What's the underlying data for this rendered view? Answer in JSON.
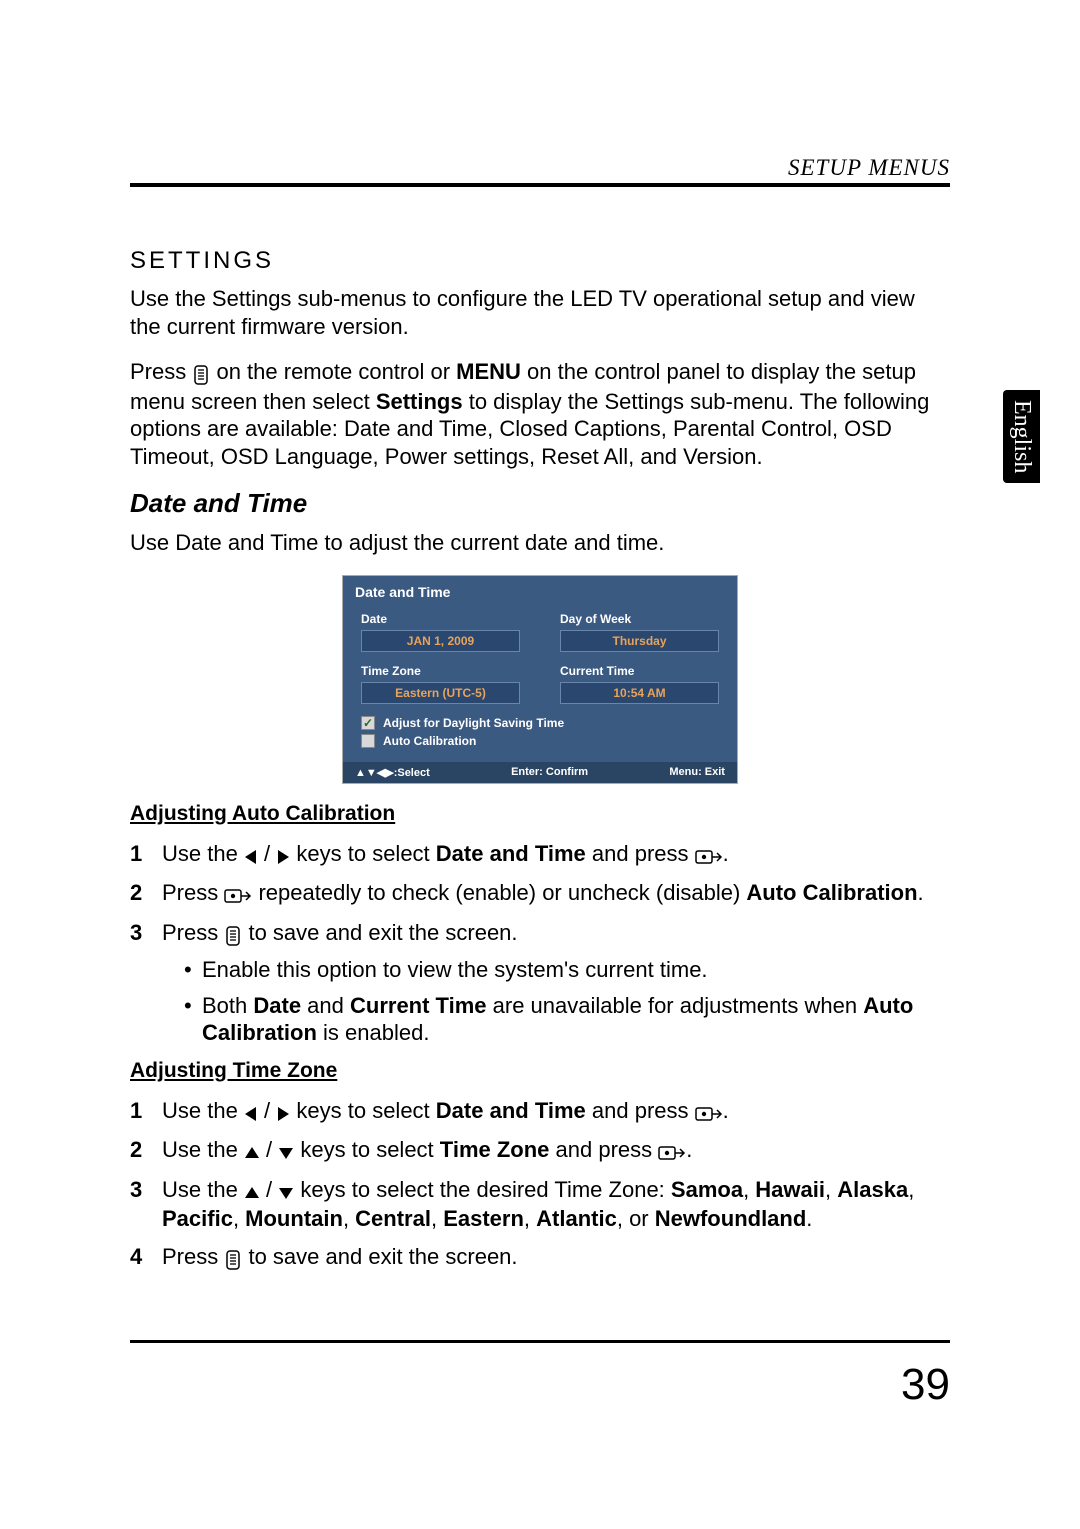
{
  "header": {
    "label": "SETUP MENUS"
  },
  "side_tab": "English",
  "page_number": "39",
  "settings": {
    "title": "SETTINGS",
    "intro": "Use the Settings sub-menus to configure the LED TV operational setup and view the current firmware version.",
    "press_pre": "Press ",
    "press_mid1": " on the remote control or ",
    "press_menu": "MENU",
    "press_mid2": " on the control panel to display the setup menu screen then select ",
    "press_settings": "Settings",
    "press_tail": " to display the Settings sub-menu. The following options are available: Date and Time, Closed Captions, Parental Control, OSD Timeout, OSD Language, Power settings, Reset All, and Version."
  },
  "date_time": {
    "heading": "Date and Time",
    "intro": "Use Date and Time to adjust the current date and time."
  },
  "osd": {
    "title": "Date and Time",
    "date_label": "Date",
    "date_value": "JAN 1, 2009",
    "dow_label": "Day of Week",
    "dow_value": "Thursday",
    "tz_label": "Time Zone",
    "tz_value": "Eastern (UTC-5)",
    "ct_label": "Current Time",
    "ct_value": "10:54 AM",
    "dst_label": "Adjust for Daylight Saving Time",
    "auto_label": "Auto Calibration",
    "footer_select": "▲▼◀▶:Select",
    "footer_enter": "Enter: Confirm",
    "footer_menu": "Menu: Exit"
  },
  "auto_cal": {
    "heading": "Adjusting Auto Calibration",
    "step1_a": "Use the ",
    "step1_b": " keys to select ",
    "step1_c": "Date and Time",
    "step1_d": " and press ",
    "step2_a": "Press ",
    "step2_b": " repeatedly to check (enable) or uncheck (disable) ",
    "step2_c": "Auto Calibration",
    "step3_a": "Press ",
    "step3_b": " to save and exit the screen.",
    "bullet1": "Enable this option to view the system's current time.",
    "bullet2_a": "Both ",
    "bullet2_b": "Date",
    "bullet2_c": " and ",
    "bullet2_d": "Current Time",
    "bullet2_e": " are unavailable for adjustments when ",
    "bullet2_f": "Auto Calibration",
    "bullet2_g": " is enabled."
  },
  "tz": {
    "heading": "Adjusting Time Zone",
    "step1_a": "Use the ",
    "step1_b": " keys to select ",
    "step1_c": "Date and Time",
    "step1_d": " and press ",
    "step2_a": "Use the ",
    "step2_b": " keys to select ",
    "step2_c": "Time Zone",
    "step2_d": " and press ",
    "step3_a": "Use the ",
    "step3_b": " keys to select the desired Time Zone: ",
    "step3_zones_a": "Samoa",
    "step3_zones_b": "Hawaii",
    "step3_zones_c": "Alaska",
    "step3_zones_d": "Pacific",
    "step3_zones_e": "Mountain",
    "step3_zones_f": "Central",
    "step3_zones_g": "Eastern",
    "step3_zones_h": "Atlantic",
    "step3_or": ", or ",
    "step3_zones_i": "Newfoundland",
    "step4_a": "Press ",
    "step4_b": " to save and exit the screen."
  },
  "glyphs": {
    "slash": " / ",
    "comma": ", ",
    "period": "."
  }
}
